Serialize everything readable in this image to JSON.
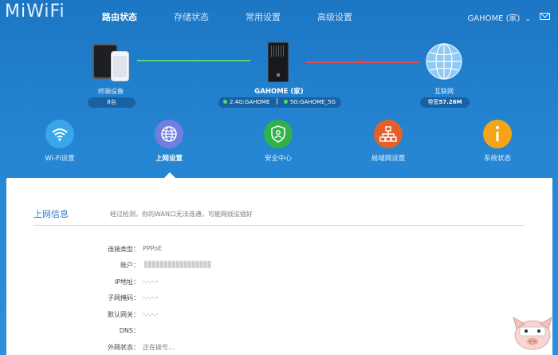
{
  "header": {
    "logo": "MiWiFi",
    "tabs": [
      {
        "label": "路由状态",
        "active": true
      },
      {
        "label": "存储状态",
        "active": false
      },
      {
        "label": "常用设置",
        "active": false
      },
      {
        "label": "高级设置",
        "active": false
      }
    ],
    "user": "GAHOME (家)",
    "chevron": "chevron-down-icon",
    "mail_icon": "mail-icon"
  },
  "topology": {
    "terminal": {
      "label": "终端设备",
      "count": "8台"
    },
    "router": {
      "name": "GAHOME (家)",
      "ssid_24": "2.4G:GAHOME",
      "ssid_5": "5G:GAHOME_5G"
    },
    "internet": {
      "label": "互联网",
      "bandwidth_label": "带宽",
      "bandwidth_value": "57.26M"
    },
    "colors": {
      "connected": "#53d67a",
      "disconnected": "#e04b55"
    }
  },
  "functions": [
    {
      "label": "Wi-Fi设置",
      "icon": "wifi-icon",
      "color": "#3aa6ea"
    },
    {
      "label": "上网设置",
      "icon": "globe-icon",
      "color": "#6f7fe0",
      "active": true
    },
    {
      "label": "安全中心",
      "icon": "shield-icon",
      "color": "#2fb24a"
    },
    {
      "label": "局域网设置",
      "icon": "network-icon",
      "color": "#e2612b"
    },
    {
      "label": "系统状态",
      "icon": "info-icon",
      "color": "#f5a418"
    }
  ],
  "panel": {
    "title": "上网信息",
    "description": "经过检测，你的WAN口无法连通，可能网线没插好",
    "rows": [
      {
        "label": "连接类型：",
        "value": "PPPoE"
      },
      {
        "label": "账户：",
        "value": ""
      },
      {
        "label": "IP地址：",
        "value": "-.-.-.-"
      },
      {
        "label": "子网掩码：",
        "value": "-.-.-.-"
      },
      {
        "label": "默认网关：",
        "value": "-.-.-.-"
      },
      {
        "label": "DNS：",
        "value": ""
      },
      {
        "label": "外网状态：",
        "value": "正在拨号..."
      }
    ]
  }
}
